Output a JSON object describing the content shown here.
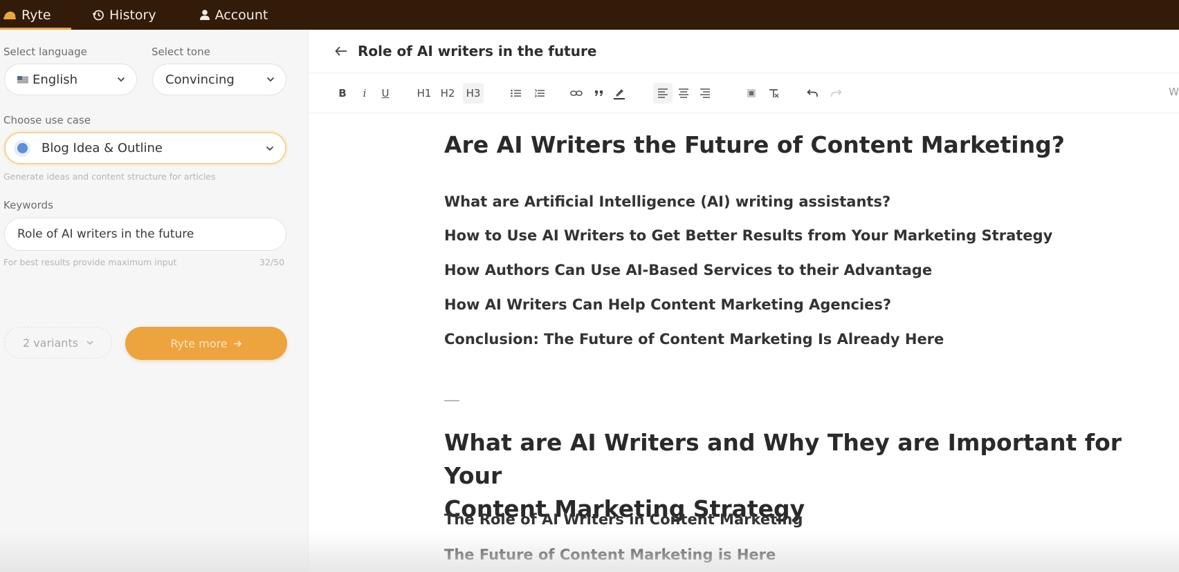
{
  "nav": {
    "brand": "Ryte",
    "history": "History",
    "account": "Account"
  },
  "sidebar": {
    "language_label": "Select language",
    "language_value": "English",
    "tone_label": "Select tone",
    "tone_value": "Convincing",
    "usecase_label": "Choose use case",
    "usecase_value": "Blog Idea & Outline",
    "usecase_helper": "Generate ideas and content structure for articles",
    "keywords_label": "Keywords",
    "keywords_value": "Role of AI writers in the future",
    "keywords_helper": "For best results provide maximum input",
    "keywords_count": "32/50",
    "variants_value": "2 variants",
    "ryte_button": "Ryte more"
  },
  "editor": {
    "title": "Role of AI writers in the future",
    "toolbar": {
      "bold": "B",
      "italic": "i",
      "underline": "U",
      "h1": "H1",
      "h2": "H2",
      "h3": "H3",
      "right_text": "W"
    },
    "content": {
      "heading1": "Are AI Writers the Future of Content Marketing?",
      "subheads1": [
        "What are Artificial Intelligence (AI) writing assistants?",
        "How to Use AI Writers to Get Better Results from Your Marketing Strategy",
        "How Authors Can Use AI-Based Services to their Advantage",
        "How AI Writers Can Help Content Marketing Agencies?",
        "Conclusion: The Future of Content Marketing Is Already Here"
      ],
      "heading2_line1": "What are AI Writers and Why They are Important for Your",
      "heading2_line2": "Content Marketing Strategy",
      "subheads2": [
        "The Role of AI Writers in Content Marketing",
        "The Future of Content Marketing is Here"
      ]
    }
  },
  "colors": {
    "topbar": "#331b09",
    "accent": "#eda43e",
    "usecase_dot": "#5b8fd6"
  }
}
